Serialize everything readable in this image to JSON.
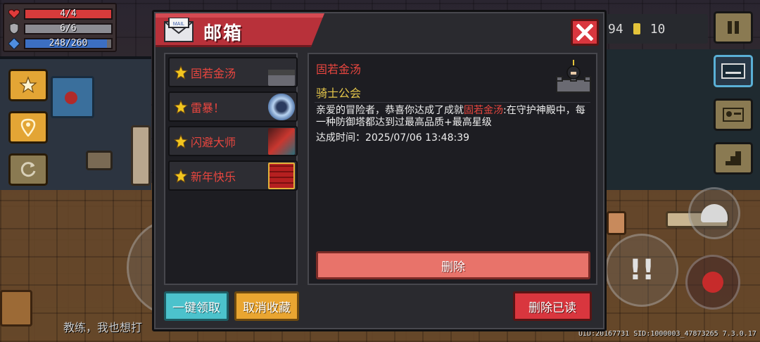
{
  "hud": {
    "health": "4/4",
    "armor": "6/6",
    "energy": "248/260",
    "gems": "94",
    "coins": "10"
  },
  "mailbox": {
    "title": "邮箱",
    "icon_text": "MAIL",
    "list": [
      {
        "label": "固若金汤",
        "icon": "tower-knight-icon"
      },
      {
        "label": "雷暴！",
        "icon": "thunder-vortex-icon"
      },
      {
        "label": "闪避大师",
        "icon": "dodge-dragon-icon"
      },
      {
        "label": "新年快乐",
        "icon": "firecracker-icon"
      }
    ],
    "detail": {
      "title": "固若金汤",
      "sender": "骑士公会",
      "body_pre": "亲爱的冒险者，恭喜你达成了成就",
      "body_highlight": "固若金汤",
      "body_post": ":在守护神殿中，每一种防御塔都达到过最高品质+最高星级",
      "time": "达成时间：2025/07/06 13:48:39",
      "delete_label": "删除"
    },
    "buttons": {
      "claim_all": "一键领取",
      "unfavorite": "取消收藏",
      "delete_read": "删除已读"
    }
  },
  "chat": "教练，我也想打",
  "uid_line": "UID:20167731 SID:1000003_47873265 7.3.0.17",
  "colors": {
    "accent_red": "#d9363e",
    "highlight_red": "#e9463f",
    "sender_yellow": "#e3c54a",
    "claim_cyan": "#4cc2cc",
    "unfav_orange": "#e9a531",
    "delete_salmon": "#e8736a"
  }
}
